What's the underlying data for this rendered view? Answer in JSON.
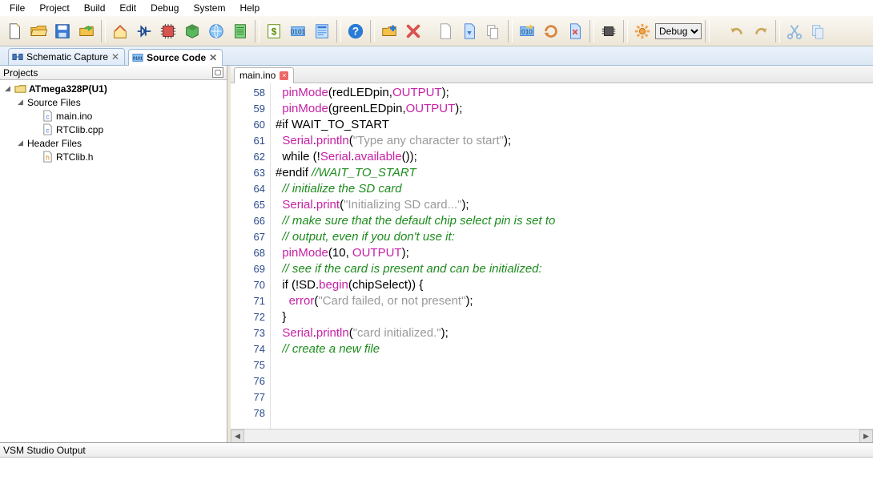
{
  "menu": [
    "File",
    "Project",
    "Build",
    "Edit",
    "Debug",
    "System",
    "Help"
  ],
  "config_select": "Debug",
  "doc_tabs": {
    "schematic": "Schematic Capture",
    "source": "Source Code"
  },
  "projects_panel": {
    "title": "Projects",
    "root": "ATmega328P(U1)",
    "src_group": "Source Files",
    "src_files": [
      "main.ino",
      "RTClib.cpp"
    ],
    "hdr_group": "Header Files",
    "hdr_files": [
      "RTClib.h"
    ]
  },
  "editor_tab": "main.ino",
  "line_start": 58,
  "code_lines": [
    [
      [
        "  ",
        0
      ],
      [
        "pinMode",
        1
      ],
      [
        "(redLEDpin,",
        0
      ],
      [
        "OUTPUT",
        1
      ],
      [
        ");",
        0
      ]
    ],
    [
      [
        "  ",
        0
      ],
      [
        "pinMode",
        1
      ],
      [
        "(greenLEDpin,",
        0
      ],
      [
        "OUTPUT",
        1
      ],
      [
        ");",
        0
      ]
    ],
    [
      [
        "",
        0
      ]
    ],
    [
      [
        "#if WAIT_TO_START",
        0
      ]
    ],
    [
      [
        "  ",
        0
      ],
      [
        "Serial",
        1
      ],
      [
        ".",
        0
      ],
      [
        "println",
        1
      ],
      [
        "(",
        0
      ],
      [
        "\"Type any character to start\"",
        2
      ],
      [
        ");",
        0
      ]
    ],
    [
      [
        "  while (!",
        0
      ],
      [
        "Serial",
        1
      ],
      [
        ".",
        0
      ],
      [
        "available",
        1
      ],
      [
        "());",
        0
      ]
    ],
    [
      [
        "#endif ",
        0
      ],
      [
        "//WAIT_TO_START",
        3
      ]
    ],
    [
      [
        "",
        0
      ]
    ],
    [
      [
        "  ",
        0
      ],
      [
        "// initialize the SD card",
        3
      ]
    ],
    [
      [
        "  ",
        0
      ],
      [
        "Serial",
        1
      ],
      [
        ".",
        0
      ],
      [
        "print",
        1
      ],
      [
        "(",
        0
      ],
      [
        "\"Initializing SD card...\"",
        2
      ],
      [
        ");",
        0
      ]
    ],
    [
      [
        "  ",
        0
      ],
      [
        "// make sure that the default chip select pin is set to",
        3
      ]
    ],
    [
      [
        "  ",
        0
      ],
      [
        "// output, even if you don't use it:",
        3
      ]
    ],
    [
      [
        "  ",
        0
      ],
      [
        "pinMode",
        1
      ],
      [
        "(10, ",
        0
      ],
      [
        "OUTPUT",
        1
      ],
      [
        ");",
        0
      ]
    ],
    [
      [
        "",
        0
      ]
    ],
    [
      [
        "  ",
        0
      ],
      [
        "// see if the card is present and can be initialized:",
        3
      ]
    ],
    [
      [
        "  if (!SD.",
        0
      ],
      [
        "begin",
        1
      ],
      [
        "(chipSelect)) {",
        0
      ]
    ],
    [
      [
        "    ",
        0
      ],
      [
        "error",
        1
      ],
      [
        "(",
        0
      ],
      [
        "\"Card failed, or not present\"",
        2
      ],
      [
        ");",
        0
      ]
    ],
    [
      [
        "  }",
        0
      ]
    ],
    [
      [
        "  ",
        0
      ],
      [
        "Serial",
        1
      ],
      [
        ".",
        0
      ],
      [
        "println",
        1
      ],
      [
        "(",
        0
      ],
      [
        "\"card initialized.\"",
        2
      ],
      [
        ");",
        0
      ]
    ],
    [
      [
        "",
        0
      ]
    ],
    [
      [
        "  ",
        0
      ],
      [
        "// create a new file",
        3
      ]
    ]
  ],
  "output_title": "VSM Studio Output"
}
